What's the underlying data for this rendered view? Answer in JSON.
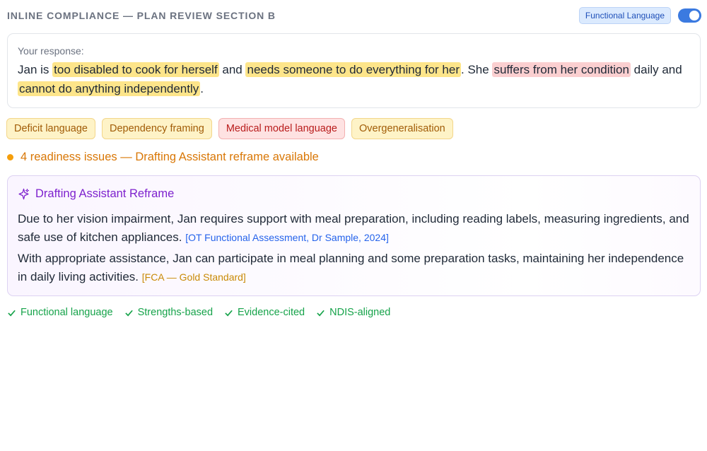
{
  "header": {
    "title": "INLINE COMPLIANCE — PLAN REVIEW SECTION B",
    "mode_badge": "Functional Language",
    "toggle_on": true
  },
  "response": {
    "label": "Your response:",
    "segments": [
      {
        "text": "Jan is ",
        "type": "plain"
      },
      {
        "text": "too disabled to cook for herself",
        "type": "deficit"
      },
      {
        "text": " and ",
        "type": "plain"
      },
      {
        "text": "needs someone to do everything for her",
        "type": "dependency"
      },
      {
        "text": ". She ",
        "type": "plain"
      },
      {
        "text": "suffers from her condition",
        "type": "medical"
      },
      {
        "text": " daily and ",
        "type": "plain"
      },
      {
        "text": "cannot do anything independently",
        "type": "overgeneral"
      },
      {
        "text": ".",
        "type": "plain"
      }
    ]
  },
  "tags": [
    {
      "label": "Deficit language",
      "severity": "amber"
    },
    {
      "label": "Dependency framing",
      "severity": "amber"
    },
    {
      "label": "Medical model language",
      "severity": "red"
    },
    {
      "label": "Overgeneralisation",
      "severity": "amber"
    }
  ],
  "issues": {
    "text": "4 readiness issues — Drafting Assistant reframe available"
  },
  "reframe": {
    "title": "Drafting Assistant Reframe",
    "icon": "sparkle-icon",
    "paragraphs": [
      {
        "text": "Due to her vision impairment, Jan requires support with meal preparation, including reading labels, measuring ingredients, and safe use of kitchen appliances.",
        "citation": "[OT Functional Assessment, Dr Sample, 2024]",
        "citation_color": "blue"
      },
      {
        "text": "With appropriate assistance, Jan can participate in meal planning and some preparation tasks, maintaining her independence in daily living activities.",
        "citation": "[FCA — Gold Standard]",
        "citation_color": "gold"
      }
    ]
  },
  "checks": [
    {
      "label": "Functional language"
    },
    {
      "label": "Strengths-based"
    },
    {
      "label": "Evidence-cited"
    },
    {
      "label": "NDIS-aligned"
    }
  ],
  "colors": {
    "accent": "#3b7ae0",
    "highlight_yellow": "#fde58a",
    "highlight_red": "#fbcfd0",
    "warning": "#d97706",
    "reframe_purple": "#7e22ce",
    "success": "#16a34a"
  }
}
